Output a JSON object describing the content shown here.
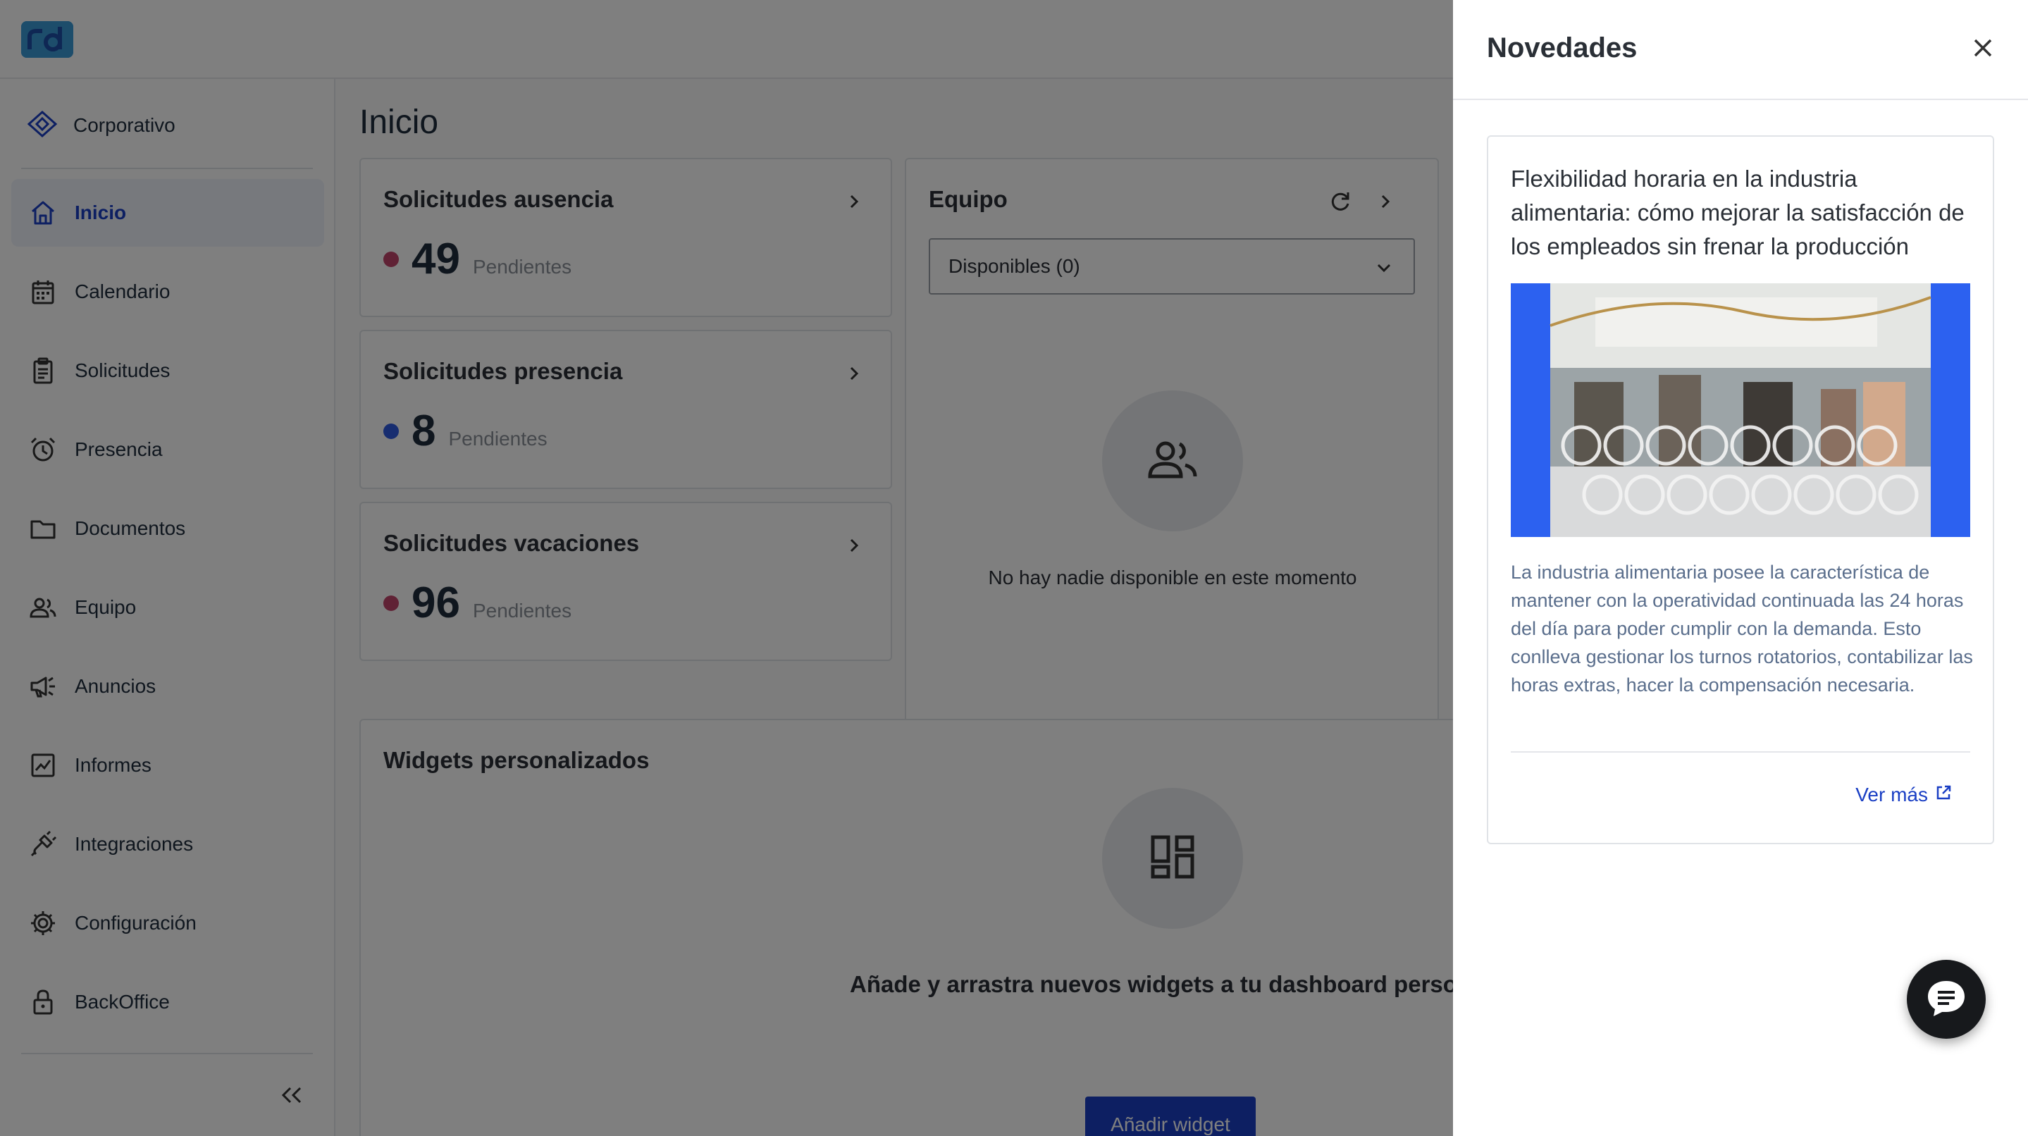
{
  "colors": {
    "accent": "#1a3fc4",
    "absence_dot": "#c1456a",
    "presence_dot": "#2f5be0",
    "vacation_dot": "#c1456a"
  },
  "sidebar": {
    "company": {
      "label": "Corporativo",
      "icon": "diamond-icon"
    },
    "items": [
      {
        "label": "Inicio",
        "icon": "home-icon",
        "active": true
      },
      {
        "label": "Calendario",
        "icon": "calendar-icon"
      },
      {
        "label": "Solicitudes",
        "icon": "clipboard-icon"
      },
      {
        "label": "Presencia",
        "icon": "alarm-clock-icon"
      },
      {
        "label": "Documentos",
        "icon": "folder-icon"
      },
      {
        "label": "Equipo",
        "icon": "people-icon"
      },
      {
        "label": "Anuncios",
        "icon": "megaphone-icon"
      },
      {
        "label": "Informes",
        "icon": "chart-icon"
      },
      {
        "label": "Integraciones",
        "icon": "plug-icon"
      },
      {
        "label": "Configuración",
        "icon": "gear-icon"
      },
      {
        "label": "BackOffice",
        "icon": "lock-icon"
      }
    ]
  },
  "main": {
    "title": "Inicio",
    "requests": [
      {
        "title": "Solicitudes ausencia",
        "value": "49",
        "label": "Pendientes"
      },
      {
        "title": "Solicitudes presencia",
        "value": "8",
        "label": "Pendientes"
      },
      {
        "title": "Solicitudes vacaciones",
        "value": "96",
        "label": "Pendientes"
      }
    ],
    "team": {
      "title": "Equipo",
      "select_value": "Disponibles (0)",
      "empty_text": "No hay nadie disponible en este momento"
    },
    "widgets": {
      "title": "Widgets personalizados",
      "empty_text": "Añade y arrastra nuevos widgets a tu dashboard personaliz",
      "button_label": "Añadir widget"
    }
  },
  "drawer": {
    "title": "Novedades",
    "news": {
      "title": "Flexibilidad horaria en la industria alimentaria: cómo mejorar la satisfacción de los empleados sin frenar la producción",
      "body": "La industria alimentaria posee la característica de mantener con la operatividad continuada las 24 horas del día para poder cumplir con la demanda. Esto conlleva gestionar los turnos rotatorios, contabilizar las horas extras, hacer la compensación necesaria.",
      "link_label": "Ver más"
    }
  }
}
